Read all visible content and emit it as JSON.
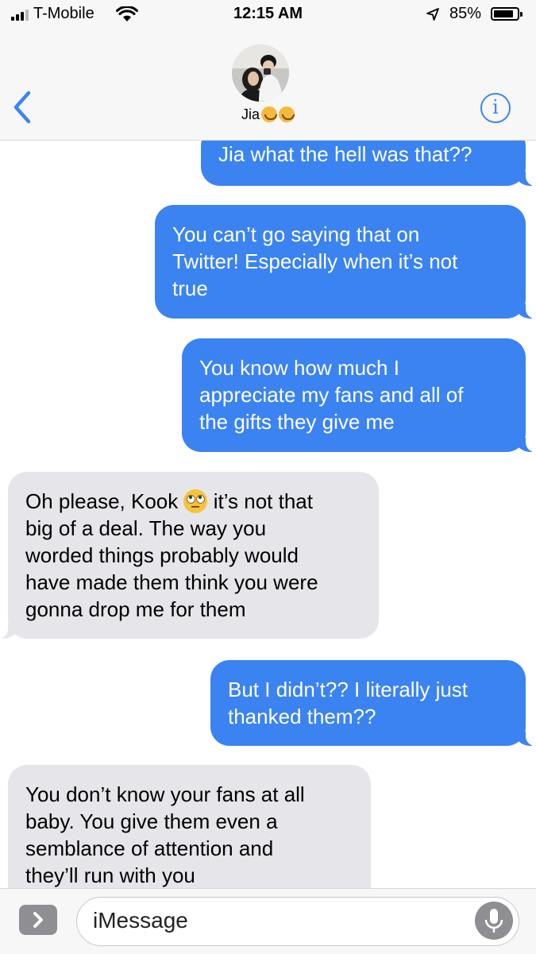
{
  "status": {
    "carrier": "T-Mobile",
    "time": "12:15 AM",
    "battery": "85%",
    "battery_level": 0.85
  },
  "header": {
    "contact_name": "Jia",
    "contact_emoji": "🥰🥰",
    "icons": [
      "back-chevron-icon",
      "avatar",
      "info-icon"
    ]
  },
  "messages": [
    {
      "side": "out",
      "text": "Jia what the hell was that??"
    },
    {
      "side": "out",
      "lines": [
        "You can’t go saying that on",
        "Twitter! Especially when it’s not",
        "true"
      ]
    },
    {
      "side": "out",
      "lines": [
        "You know how much I",
        "appreciate my fans and all of",
        "the gifts they give me"
      ]
    },
    {
      "side": "in",
      "line1_before": "Oh please, Kook",
      "emoji": "face-with-rolling-eyes",
      "line1_after": "it’s not that",
      "lines": [
        "big of a deal. The way you",
        "worded things probably would",
        "have made them think you were",
        "gonna drop me for them"
      ]
    },
    {
      "side": "out",
      "lines": [
        "But I didn’t?? I literally just",
        "thanked them??"
      ]
    },
    {
      "side": "in",
      "lines": [
        "You don’t know your fans at all",
        "baby. You give them even a",
        "semblance of attention and",
        "they’ll run with you"
      ]
    }
  ],
  "input": {
    "placeholder": "iMessage"
  },
  "colors": {
    "outgoing": "#3b83f1",
    "incoming": "#e5e5ea",
    "accent": "#3a86f0"
  }
}
